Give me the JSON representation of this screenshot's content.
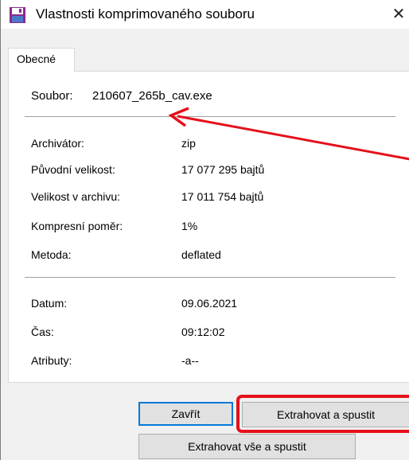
{
  "window": {
    "title": "Vlastnosti komprimovaného souboru",
    "close_glyph": "✕"
  },
  "tabs": [
    {
      "label": "Obecné",
      "active": true
    }
  ],
  "file": {
    "label": "Soubor:",
    "value": "210607_265b_cav.exe"
  },
  "archive_info": [
    {
      "label": "Archivátor:",
      "value": "zip"
    },
    {
      "label": "Původní velikost:",
      "value": "17 077 295 bajtů"
    },
    {
      "label": "Velikost v archivu:",
      "value": "17 011 754 bajtů"
    },
    {
      "label": "Kompresní poměr:",
      "value": "1%"
    },
    {
      "label": "Metoda:",
      "value": "deflated"
    }
  ],
  "date_info": [
    {
      "label": "Datum:",
      "value": "09.06.2021"
    },
    {
      "label": "Čas:",
      "value": "09:12:02"
    },
    {
      "label": "Atributy:",
      "value": "-a--"
    }
  ],
  "buttons": {
    "close": "Zavřít",
    "extract_run": "Extrahovat a spustit",
    "extract_all_run": "Extrahovat vše a spustit"
  },
  "colors": {
    "annotation": "#e5101a",
    "focus": "#0078d7",
    "icon_frame": "#8b2a8f",
    "icon_fill": "#4a7ac8"
  },
  "icons": {
    "app": "floppy-disk-icon"
  }
}
